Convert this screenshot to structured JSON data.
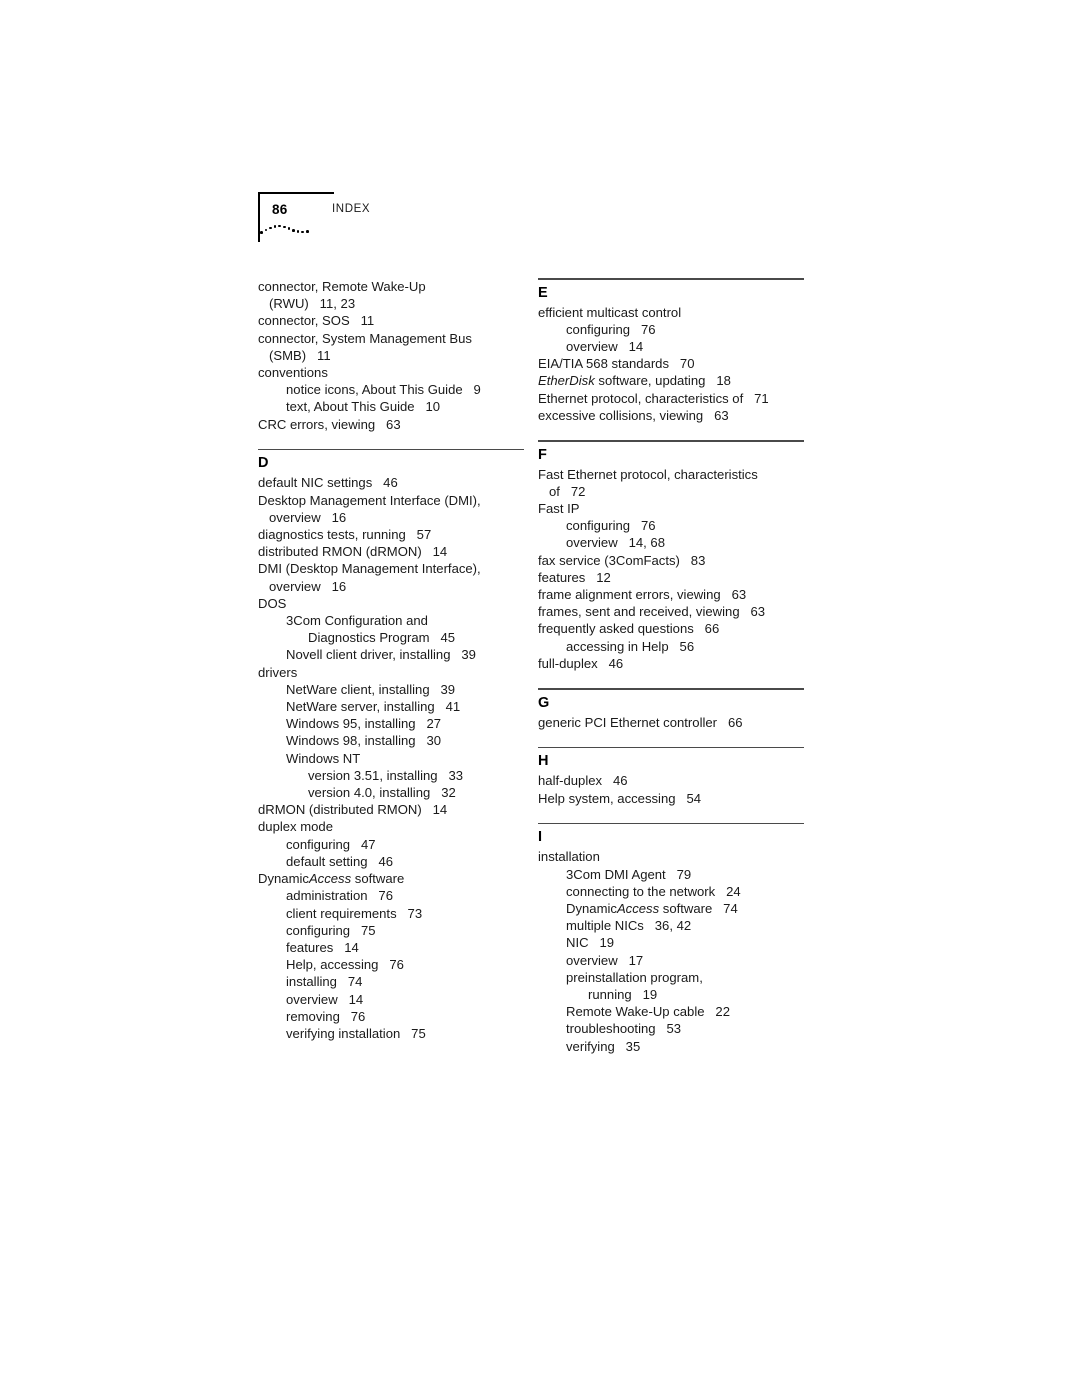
{
  "header": {
    "page_number": "86",
    "title": "INDEX"
  },
  "columns": [
    {
      "name": "left-column",
      "sections": [
        {
          "letter": "",
          "rule": false,
          "entries": [
            {
              "level": 0,
              "text": "connector, Remote Wake-Up"
            },
            {
              "level": 1,
              "text": "(RWU)   11, 23"
            },
            {
              "level": 0,
              "text": "connector, SOS   11"
            },
            {
              "level": 0,
              "text": "connector, System Management Bus"
            },
            {
              "level": 1,
              "text": "(SMB)   11"
            },
            {
              "level": 0,
              "text": "conventions"
            },
            {
              "level": 2,
              "text": "notice icons, About This Guide   9"
            },
            {
              "level": 2,
              "text": "text, About This Guide   10"
            },
            {
              "level": 0,
              "text": "CRC errors, viewing   63"
            }
          ]
        },
        {
          "letter": "D",
          "rule": true,
          "entries": [
            {
              "level": 0,
              "text": "default NIC settings   46"
            },
            {
              "level": 0,
              "text": "Desktop Management Interface (DMI),"
            },
            {
              "level": 1,
              "text": "overview   16"
            },
            {
              "level": 0,
              "text": "diagnostics tests, running   57"
            },
            {
              "level": 0,
              "text": "distributed RMON (dRMON)   14"
            },
            {
              "level": 0,
              "text": "DMI (Desktop Management Interface),"
            },
            {
              "level": 1,
              "text": "overview   16"
            },
            {
              "level": 0,
              "text": "DOS"
            },
            {
              "level": 2,
              "text": "3Com Configuration and"
            },
            {
              "level": 3,
              "text": "Diagnostics Program   45"
            },
            {
              "level": 2,
              "text": "Novell client driver, installing   39"
            },
            {
              "level": 0,
              "text": "drivers"
            },
            {
              "level": 2,
              "text": "NetWare client, installing   39"
            },
            {
              "level": 2,
              "text": "NetWare server, installing   41"
            },
            {
              "level": 2,
              "text": "Windows 95, installing   27"
            },
            {
              "level": 2,
              "text": "Windows 98, installing   30"
            },
            {
              "level": 2,
              "text": "Windows NT"
            },
            {
              "level": 3,
              "text": "version 3.51, installing   33"
            },
            {
              "level": 3,
              "text": "version 4.0, installing   32"
            },
            {
              "level": 0,
              "text": "dRMON (distributed RMON)   14"
            },
            {
              "level": 0,
              "text": "duplex mode"
            },
            {
              "level": 2,
              "text": "configuring   47"
            },
            {
              "level": 2,
              "text": "default setting   46"
            },
            {
              "level": 0,
              "text": "DynamicAccess software",
              "italic_part": "Access",
              "prefix": "Dynamic",
              "suffix": " software"
            },
            {
              "level": 2,
              "text": "administration   76"
            },
            {
              "level": 2,
              "text": "client requirements   73"
            },
            {
              "level": 2,
              "text": "configuring   75"
            },
            {
              "level": 2,
              "text": "features   14"
            },
            {
              "level": 2,
              "text": "Help, accessing   76"
            },
            {
              "level": 2,
              "text": "installing   74"
            },
            {
              "level": 2,
              "text": "overview   14"
            },
            {
              "level": 2,
              "text": "removing   76"
            },
            {
              "level": 2,
              "text": "verifying installation   75"
            }
          ]
        }
      ]
    },
    {
      "name": "right-column",
      "sections": [
        {
          "letter": "E",
          "rule": true,
          "entries": [
            {
              "level": 0,
              "text": "efficient multicast control"
            },
            {
              "level": 2,
              "text": "configuring   76"
            },
            {
              "level": 2,
              "text": "overview   14"
            },
            {
              "level": 0,
              "text": "EIA/TIA 568 standards   70"
            },
            {
              "level": 0,
              "text": "EtherDisk software, updating   18",
              "italic_part": "EtherDisk",
              "prefix": "",
              "suffix": " software, updating   18"
            },
            {
              "level": 0,
              "text": "Ethernet protocol, characteristics of   71"
            },
            {
              "level": 0,
              "text": "excessive collisions, viewing   63"
            }
          ]
        },
        {
          "letter": "F",
          "rule": true,
          "entries": [
            {
              "level": 0,
              "text": "Fast Ethernet protocol, characteristics"
            },
            {
              "level": 1,
              "text": "of   72"
            },
            {
              "level": 0,
              "text": "Fast IP"
            },
            {
              "level": 2,
              "text": "configuring   76"
            },
            {
              "level": 2,
              "text": "overview   14, 68"
            },
            {
              "level": 0,
              "text": "fax service (3ComFacts)   83"
            },
            {
              "level": 0,
              "text": "features   12"
            },
            {
              "level": 0,
              "text": "frame alignment errors, viewing   63"
            },
            {
              "level": 0,
              "text": "frames, sent and received, viewing   63"
            },
            {
              "level": 0,
              "text": "frequently asked questions   66"
            },
            {
              "level": 2,
              "text": "accessing in Help   56"
            },
            {
              "level": 0,
              "text": "full-duplex   46"
            }
          ]
        },
        {
          "letter": "G",
          "rule": true,
          "entries": [
            {
              "level": 0,
              "text": "generic PCI Ethernet controller   66"
            }
          ]
        },
        {
          "letter": "H",
          "rule": true,
          "entries": [
            {
              "level": 0,
              "text": "half-duplex   46"
            },
            {
              "level": 0,
              "text": "Help system, accessing   54"
            }
          ]
        },
        {
          "letter": "I",
          "rule": true,
          "entries": [
            {
              "level": 0,
              "text": "installation"
            },
            {
              "level": 2,
              "text": "3Com DMI Agent   79"
            },
            {
              "level": 2,
              "text": "connecting to the network   24"
            },
            {
              "level": 2,
              "text": "DynamicAccess software   74",
              "italic_part": "Access",
              "prefix": "Dynamic",
              "suffix": " software   74"
            },
            {
              "level": 2,
              "text": "multiple NICs   36, 42"
            },
            {
              "level": 2,
              "text": "NIC   19"
            },
            {
              "level": 2,
              "text": "overview   17"
            },
            {
              "level": 2,
              "text": "preinstallation program,"
            },
            {
              "level": 3,
              "text": "running   19"
            },
            {
              "level": 2,
              "text": "Remote Wake-Up cable   22"
            },
            {
              "level": 2,
              "text": "troubleshooting   53"
            },
            {
              "level": 2,
              "text": "verifying   35"
            }
          ]
        }
      ]
    }
  ],
  "decoration": {
    "dot_wave_name": "dot-wave-ornament",
    "dot_count": 11
  },
  "colors": {
    "text": "#1a1a1a",
    "rule": "#4a4a4a",
    "header_bracket": "#000000",
    "background": "#ffffff"
  }
}
